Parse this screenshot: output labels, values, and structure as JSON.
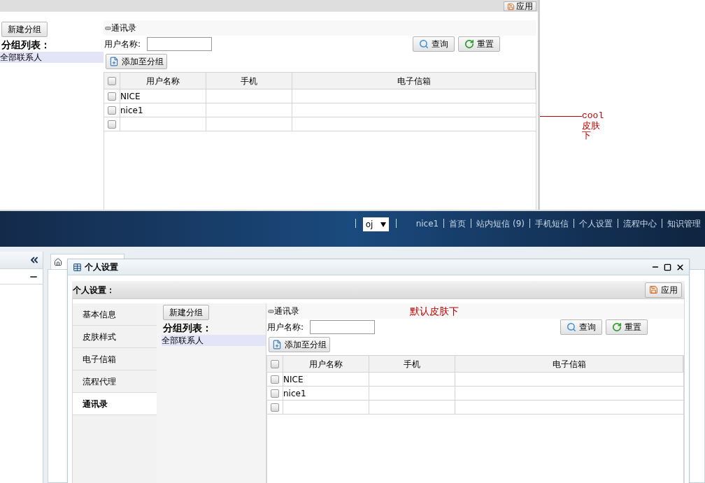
{
  "top": {
    "apply_button": "应用",
    "groups": {
      "new_button": "新建分组",
      "list_title": "分组列表：",
      "items": [
        {
          "label": "全部联系人",
          "selected": true
        }
      ]
    },
    "contacts": {
      "title": "通讯录",
      "search_label": "用户名称:",
      "query_button": "查询",
      "reset_button": "重置",
      "add_button": "添加至分组",
      "select_all_checked": false,
      "columns": [
        "用户名称",
        "手机",
        "电子信箱"
      ],
      "rows": [
        {
          "name": "NICE",
          "checked": false
        },
        {
          "name": "nice1",
          "checked": false
        },
        {
          "checked": false
        }
      ]
    },
    "annotation": [
      "cool",
      "皮肤",
      "下"
    ]
  },
  "header": {
    "select_value": "oj",
    "nav": [
      "nice1",
      "首页",
      "站内短信 (9)",
      "手机短信",
      "个人设置",
      "流程中心",
      "知识管理"
    ]
  },
  "dialog": {
    "title": "个人设置",
    "toolbar_title": "个人设置：",
    "apply_button": "应用",
    "nav": [
      {
        "label": "基本信息",
        "selected": false
      },
      {
        "label": "皮肤样式",
        "selected": false
      },
      {
        "label": "电子信箱",
        "selected": false
      },
      {
        "label": "流程代理",
        "selected": false
      },
      {
        "label": "通讯录",
        "selected": true
      }
    ],
    "groups": {
      "new_button": "新建分组",
      "list_title": "分组列表：",
      "items": [
        {
          "label": "全部联系人",
          "selected": true
        }
      ]
    },
    "contacts": {
      "title": "通讯录",
      "search_label": "用户名称:",
      "query_button": "查询",
      "reset_button": "重置",
      "add_button": "添加至分组",
      "select_all_checked": false,
      "columns": [
        "用户名称",
        "手机",
        "电子信箱"
      ],
      "rows": [
        {
          "name": "NICE",
          "checked": false
        },
        {
          "name": "nice1",
          "checked": false
        },
        {
          "checked": false
        }
      ]
    },
    "annotation": "默认皮肤下"
  }
}
